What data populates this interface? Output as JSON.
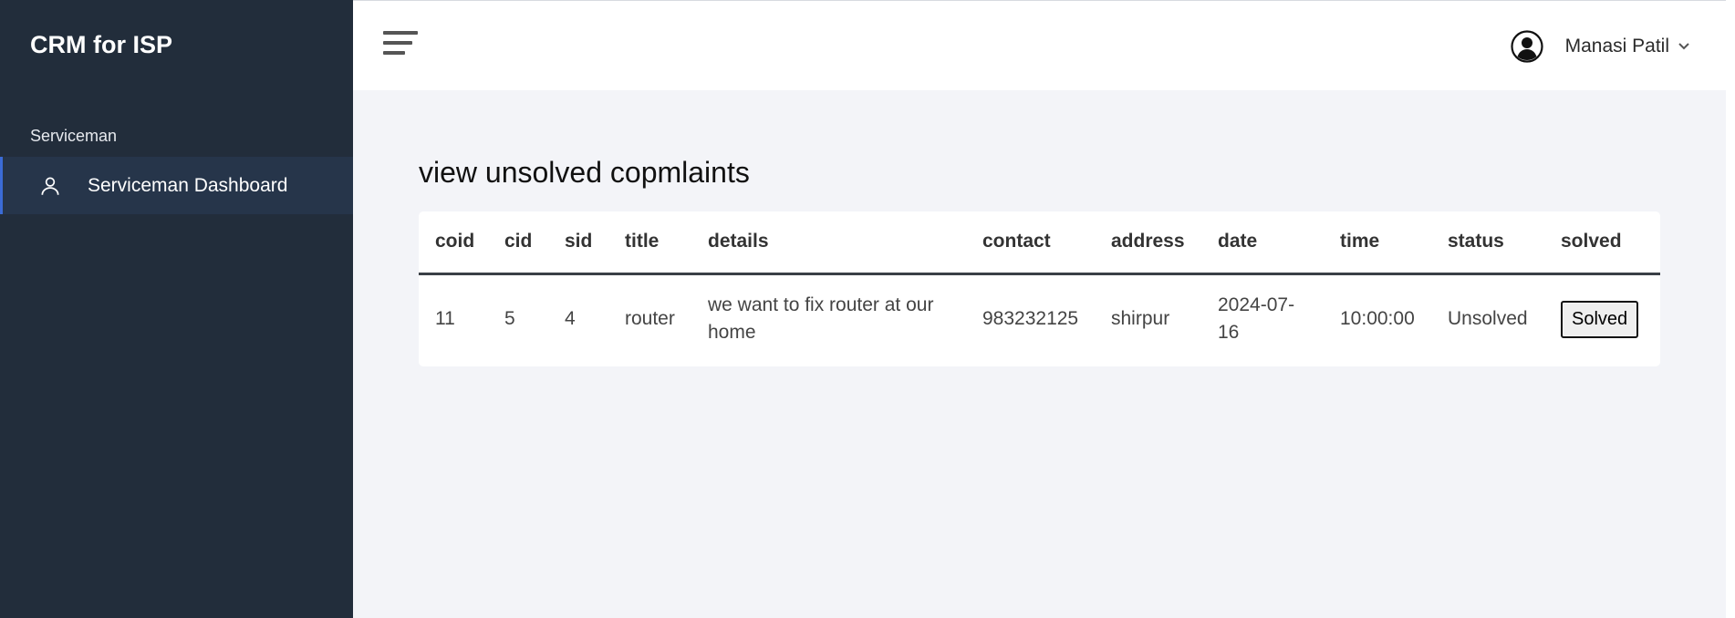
{
  "sidebar": {
    "brand": "CRM for ISP",
    "section_label": "Serviceman",
    "items": [
      {
        "label": "Serviceman Dashboard",
        "icon": "user-icon"
      }
    ],
    "colors": {
      "background": "#222d3b",
      "active_item": "#26354a",
      "accent": "#3b6bd6"
    }
  },
  "header": {
    "menu_icon": "hamburger-icon",
    "user_name": "Manasi Patil",
    "avatar_icon": "user-circle-icon",
    "dropdown_icon": "chevron-down-icon"
  },
  "main": {
    "title": "view unsolved copmlaints",
    "table": {
      "columns": [
        "coid",
        "cid",
        "sid",
        "title",
        "details",
        "contact",
        "address",
        "date",
        "time",
        "status",
        "solved"
      ],
      "rows": [
        {
          "coid": "11",
          "cid": "5",
          "sid": "4",
          "title": "router",
          "details": "we want to fix router at our home",
          "contact": "983232125",
          "address": "shirpur",
          "date": "2024-07-16",
          "time": "10:00:00",
          "status": "Unsolved",
          "action_label": "Solved"
        }
      ]
    }
  }
}
